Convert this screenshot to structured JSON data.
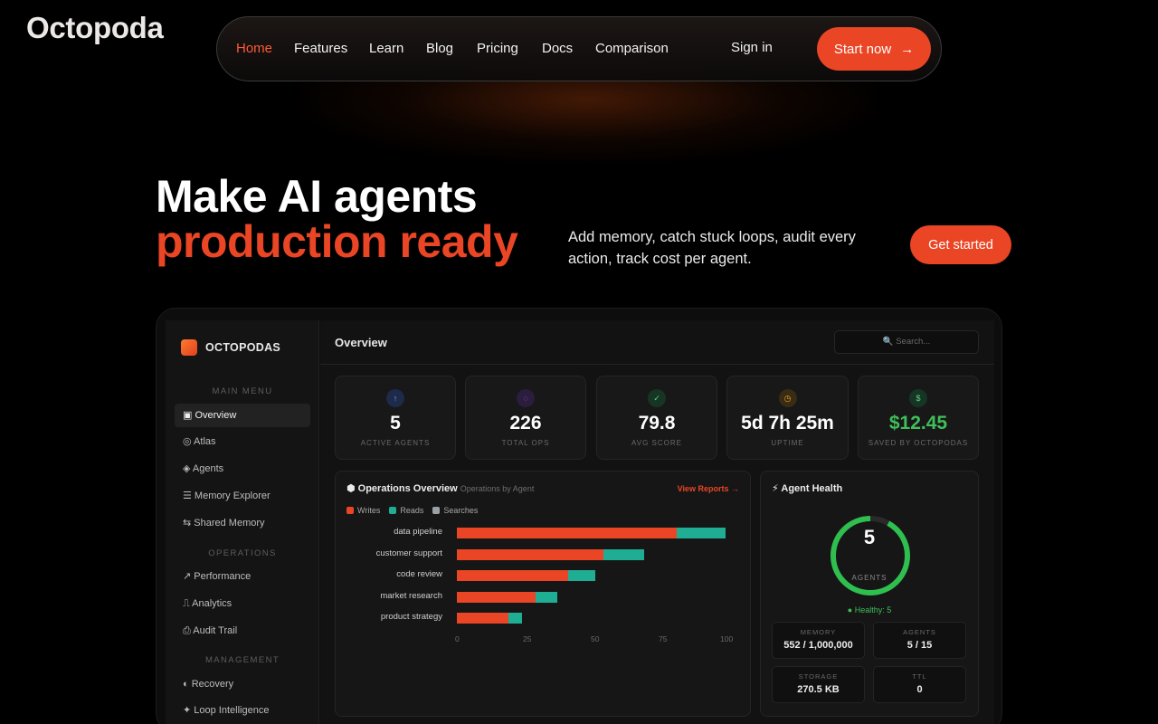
{
  "logo": "Octopoda",
  "nav": {
    "items": [
      "Home",
      "Features",
      "Learn",
      "Blog",
      "Pricing",
      "Docs",
      "Comparison"
    ],
    "active": "Home",
    "signin": "Sign in",
    "start": "Start now",
    "start_arrow": "→"
  },
  "hero": {
    "line1": "Make AI agents",
    "line2": "production ready",
    "subtitle": "Add memory, catch stuck loops, audit every action, track cost per agent.",
    "cta": "Get started"
  },
  "colors": {
    "accent": "#ea4524",
    "green": "#3fbf5a",
    "teal": "#1fae94",
    "gray": "#9aa0a6"
  },
  "dashboard": {
    "brand": "OCTOPODAS",
    "sidebar": {
      "sections": [
        "MAIN MENU",
        "OPERATIONS",
        "MANAGEMENT"
      ],
      "main_menu": [
        "▣ Overview",
        "◎ Atlas",
        "◈ Agents",
        "☰ Memory Explorer",
        "⇆ Shared Memory"
      ],
      "operations": [
        "↗ Performance",
        "⎍ Analytics",
        "⎙ Audit Trail"
      ],
      "management": [
        "◐ Recovery",
        "✦ Loop Intelligence"
      ]
    },
    "title": "Overview",
    "search_placeholder": "🔍 Search...",
    "stats": [
      {
        "icon": "↑",
        "icon_name": "arrow-up-icon",
        "value": "5",
        "label": "ACTIVE AGENTS",
        "color": "#3a63c9"
      },
      {
        "icon": "◌",
        "icon_name": "circle-icon",
        "value": "226",
        "label": "TOTAL OPS",
        "color": "#8a3fcf"
      },
      {
        "icon": "✓",
        "icon_name": "check-icon",
        "value": "79.8",
        "label": "AVG SCORE",
        "color": "#2e9a4d"
      },
      {
        "icon": "◷",
        "icon_name": "clock-icon",
        "value": "5d 7h 25m",
        "label": "UPTIME",
        "color": "#b8861d"
      },
      {
        "icon": "$",
        "icon_name": "dollar-icon",
        "value": "$12.45",
        "label": "SAVED BY OCTOPODAS",
        "color": "#2e9a4d"
      }
    ],
    "ops": {
      "title": "⬢ Operations Overview",
      "subtitle": "Operations by Agent",
      "view": "View Reports →",
      "legend": [
        "Writes",
        "Reads",
        "Searches"
      ]
    },
    "health": {
      "title": "⚡ Agent Health",
      "value": "5",
      "label": "AGENTS",
      "healthy": "● Healthy: 5",
      "healthy_fraction": 0.92,
      "tiles": [
        {
          "label": "MEMORY",
          "value": "552 / 1,000,000"
        },
        {
          "label": "AGENTS",
          "value": "5 / 15"
        },
        {
          "label": "STORAGE",
          "value": "270.5 KB"
        },
        {
          "label": "TTL",
          "value": "0"
        }
      ]
    }
  },
  "chart_data": {
    "type": "bar",
    "orientation": "horizontal",
    "stacked": true,
    "categories": [
      "data pipeline",
      "customer support",
      "code review",
      "market research",
      "product strategy"
    ],
    "series": [
      {
        "name": "Writes",
        "values": [
          81,
          54,
          41,
          29,
          19
        ]
      },
      {
        "name": "Reads",
        "values": [
          18,
          15,
          10,
          8,
          5
        ]
      },
      {
        "name": "Searches",
        "values": [
          0,
          0,
          0,
          0,
          0
        ]
      }
    ],
    "xticks": [
      "0",
      "25",
      "50",
      "75",
      "100"
    ],
    "xlim": [
      0,
      100
    ],
    "legend": "top-left"
  }
}
